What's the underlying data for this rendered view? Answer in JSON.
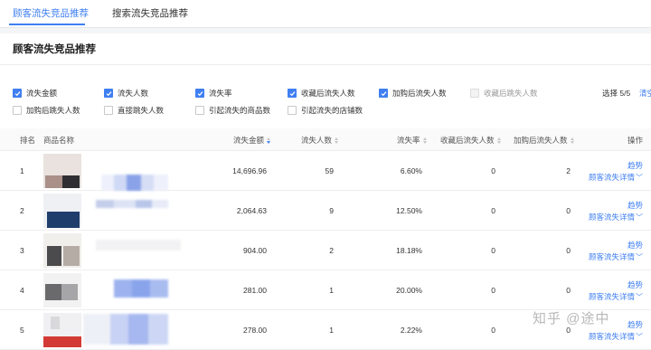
{
  "tabs": [
    {
      "label": "顾客流失竞品推荐",
      "active": true
    },
    {
      "label": "搜索流失竞品推荐",
      "active": false
    }
  ],
  "section_title": "顾客流失竞品推荐",
  "metrics": [
    {
      "label": "流失金额",
      "checked": true
    },
    {
      "label": "流失人数",
      "checked": true
    },
    {
      "label": "流失率",
      "checked": true
    },
    {
      "label": "收藏后流失人数",
      "checked": true
    },
    {
      "label": "加购后流失人数",
      "checked": true
    },
    {
      "label": "收藏后跳失人数",
      "checked": false,
      "disabled": true
    },
    {
      "label": "加购后跳失人数",
      "checked": false
    },
    {
      "label": "直接跳失人数",
      "checked": false
    },
    {
      "label": "引起流失的商品数",
      "checked": false
    },
    {
      "label": "引起流失的店铺数",
      "checked": false
    }
  ],
  "selection": {
    "count": "选择 5/5",
    "clear": "清空"
  },
  "table": {
    "headers": {
      "rank": "排名",
      "product": "商品名称",
      "amount": "流失金额",
      "people": "流失人数",
      "rate": "流失率",
      "fav_loss": "收藏后流失人数",
      "cart_loss": "加购后流失人数",
      "actions": "操作"
    },
    "rows": [
      {
        "rank": "1",
        "amount": "14,696.96",
        "people": "59",
        "rate": "6.60%",
        "fav_loss": "0",
        "cart_loss": "2",
        "trend": "趋势",
        "detail": "顾客流失详情"
      },
      {
        "rank": "2",
        "amount": "2,064.63",
        "people": "9",
        "rate": "12.50%",
        "fav_loss": "0",
        "cart_loss": "0",
        "trend": "趋势",
        "detail": "顾客流失详情"
      },
      {
        "rank": "3",
        "amount": "904.00",
        "people": "2",
        "rate": "18.18%",
        "fav_loss": "0",
        "cart_loss": "0",
        "trend": "趋势",
        "detail": "顾客流失详情"
      },
      {
        "rank": "4",
        "amount": "281.00",
        "people": "1",
        "rate": "20.00%",
        "fav_loss": "0",
        "cart_loss": "0",
        "trend": "趋势",
        "detail": "顾客流失详情"
      },
      {
        "rank": "5",
        "amount": "278.00",
        "people": "1",
        "rate": "2.22%",
        "fav_loss": "0",
        "cart_loss": "0",
        "trend": "趋势",
        "detail": "顾客流失详情"
      }
    ]
  },
  "watermark": "知乎 @途中",
  "colors": {
    "accent": "#3f7ff2",
    "header_bg": "#fafafa",
    "page_gap": "#f4f5f7"
  },
  "icons": {
    "check": "check-icon",
    "sort": "sort-caret-icon",
    "chevron": "chevron-down-icon"
  }
}
